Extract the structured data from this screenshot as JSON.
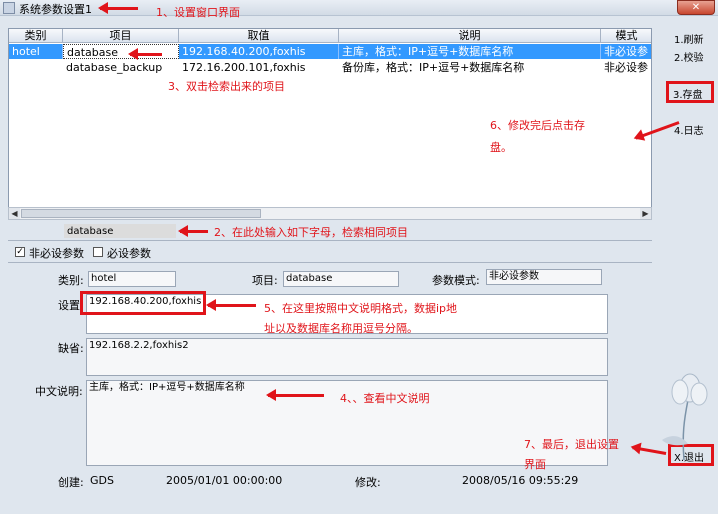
{
  "window": {
    "title": "系统参数设置1"
  },
  "grid": {
    "columns": [
      "类别",
      "项目",
      "取值",
      "说明",
      "模式"
    ],
    "rows": [
      {
        "category": "hotel",
        "item": "database",
        "value": "192.168.40.200,foxhis",
        "desc": "主库，格式：IP+逗号+数据库名称",
        "mode": "非必设参"
      },
      {
        "category": "",
        "item": "database_backup",
        "value": "172.16.200.101,foxhis",
        "desc": "备份库，格式：IP+逗号+数据库名称",
        "mode": "非必设参"
      }
    ]
  },
  "search": {
    "value": "database"
  },
  "filters": {
    "optional_label": "非必设参数",
    "optional_checked": "✓",
    "required_label": "必设参数"
  },
  "form": {
    "category_label": "类别:",
    "category_value": "hotel",
    "item_label": "项目:",
    "item_value": "database",
    "mode_label": "参数模式:",
    "mode_value": "非必设参数",
    "setting_label": "设置:",
    "setting_value": "192.168.40.200,foxhis",
    "default_label": "缺省:",
    "default_value": "192.168.2.2,foxhis2",
    "desc_label": "中文说明:",
    "desc_value": "主库，格式：IP+逗号+数据库名称",
    "created_label": "创建:",
    "created_by": "GDS",
    "created_time": "2005/01/01 00:00:00",
    "modified_label": "修改:",
    "modified_time": "2008/05/16 09:55:29"
  },
  "sidebar": {
    "refresh": "1.刷新",
    "verify": "2.校验",
    "save": "3.存盘",
    "log": "4.日志",
    "exit": "X.退出"
  },
  "annotations": {
    "a1": "1、设置窗口界面",
    "a2": "2、在此处输入如下字母，检索相同项目",
    "a3": "3、双击检索出来的项目",
    "a4": "4、、查看中文说明",
    "a5_line1": "5、在这里按照中文说明格式，数据ip地",
    "a5_line2": "址以及数据库名称用逗号分隔。",
    "a6_line1": "6、修改完后点击存",
    "a6_line2": "盘。",
    "a7_line1": "7、最后，退出设置",
    "a7_line2": "界面"
  },
  "colors": {
    "annotation": "#e0141a",
    "selection": "#3399ff",
    "window_bg": "#dfe6ee"
  }
}
